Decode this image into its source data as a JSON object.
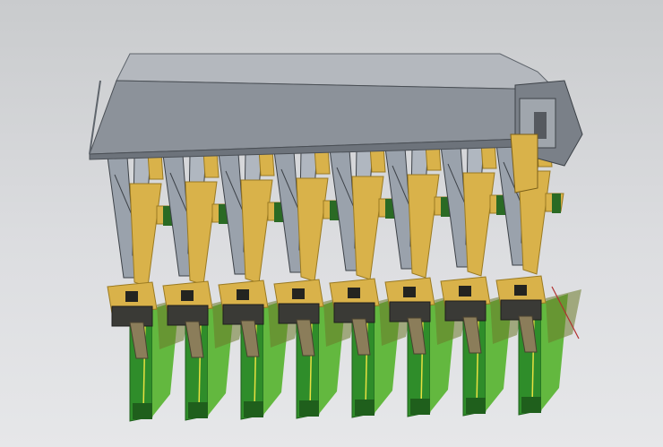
{
  "scene": {
    "colors": {
      "background_top": "#c9cbcd",
      "background_bottom": "#e6e7e9",
      "beam_top": "#b4b8be",
      "beam_face": "#8c929a",
      "beam_edge": "#5f656c",
      "arm_frame": "#9aa2ac",
      "arm_outline": "#3d4248",
      "bracket_gold": "#d9b24a",
      "bracket_dark": "#9a7a22",
      "motor_block": "#3a3a36",
      "pcb_green": "#2f8d2a",
      "pcb_light": "#63b83f",
      "pcb_dark": "#1f5f1c",
      "trace_yellow": "#e8e040",
      "wire_red": "#b03030"
    },
    "module_count": 8
  }
}
